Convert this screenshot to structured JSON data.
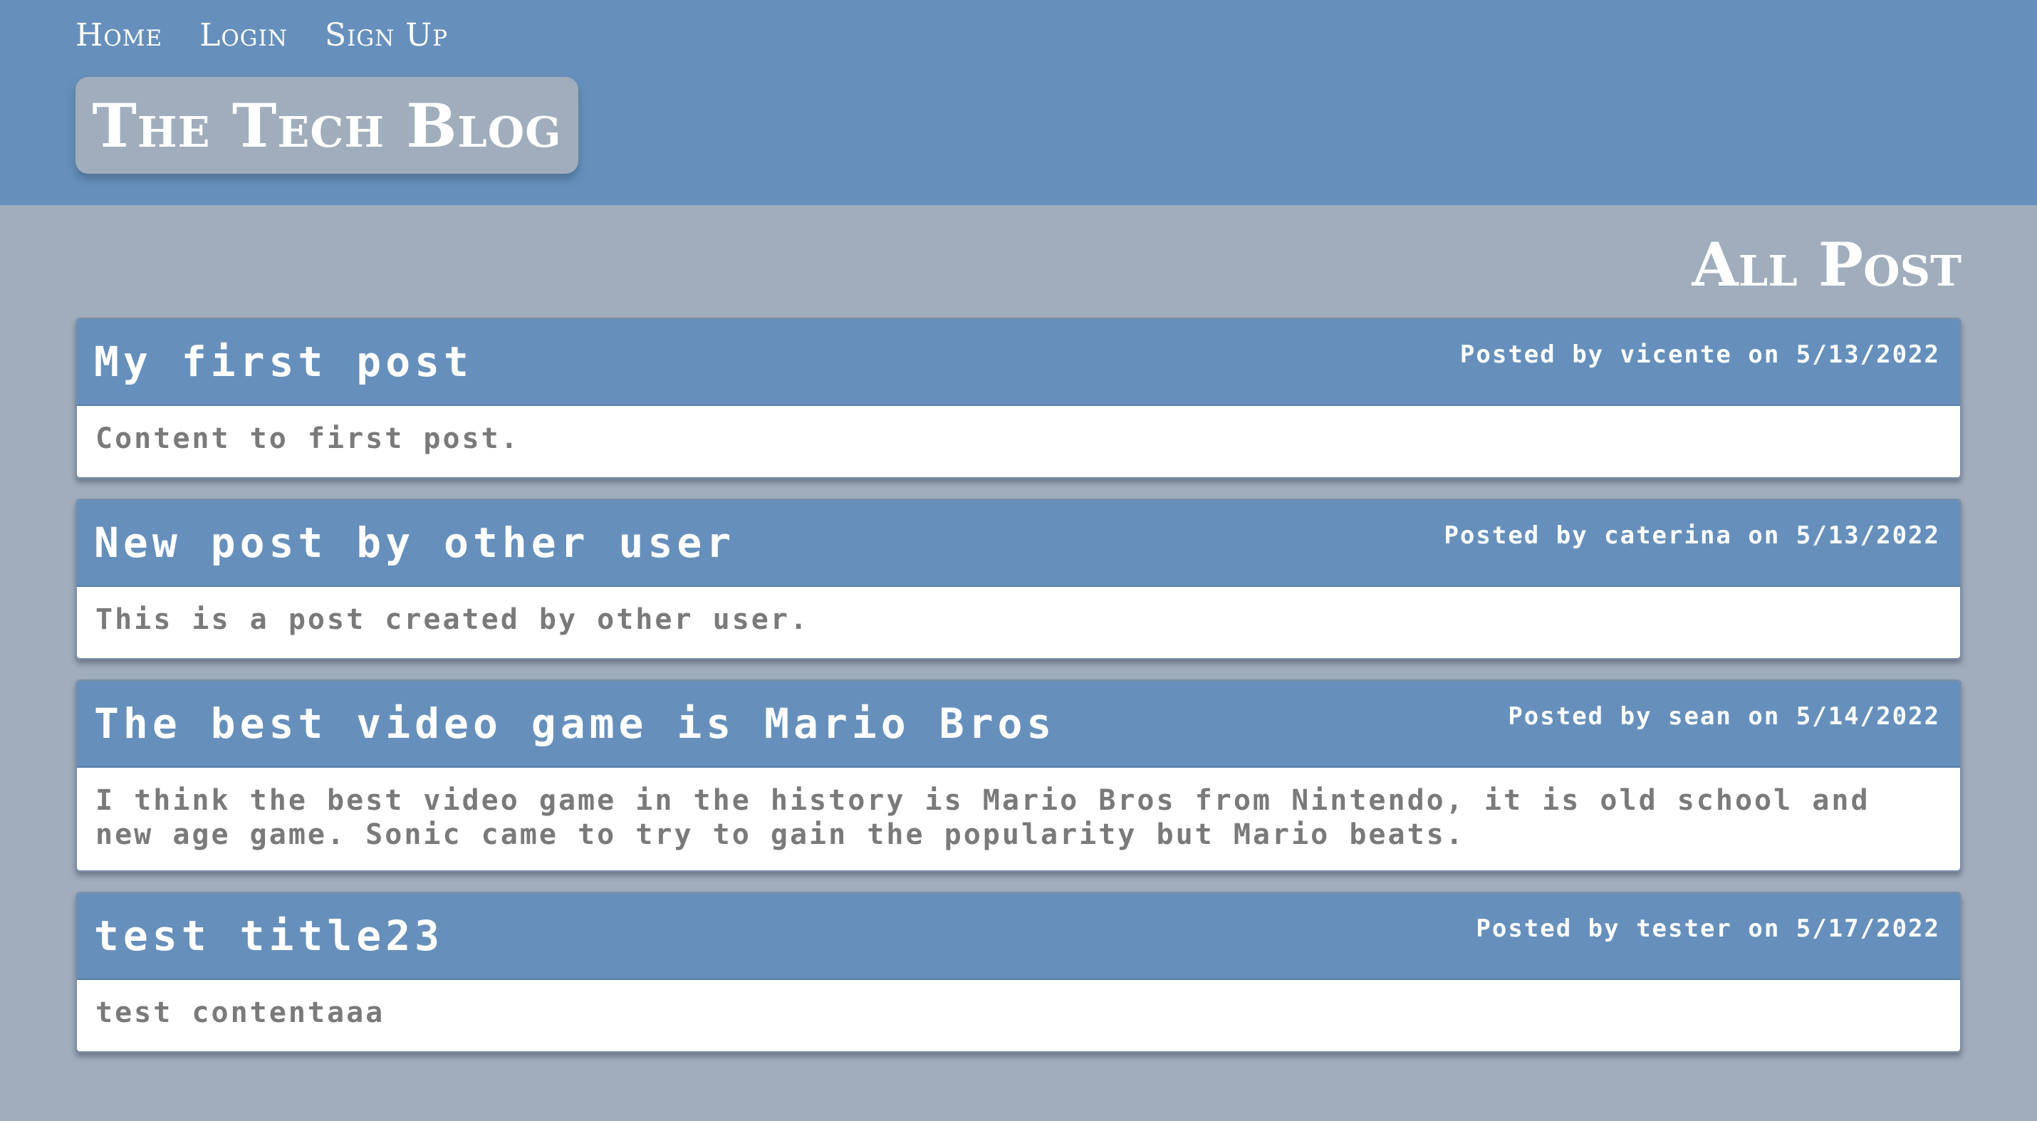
{
  "nav": {
    "home": "Home",
    "login": "Login",
    "signup": "Sign Up"
  },
  "brand": {
    "title": "The Tech Blog"
  },
  "page": {
    "heading": "All Post"
  },
  "posts": [
    {
      "title": "My first post",
      "meta": "Posted by vicente on 5/13/2022",
      "content": "Content to first post."
    },
    {
      "title": "New post by other user",
      "meta": "Posted by caterina on 5/13/2022",
      "content": "This is a post created by other user."
    },
    {
      "title": "The best video game is Mario Bros",
      "meta": "Posted by sean on 5/14/2022",
      "content": "I think the best video game in the history is Mario Bros from Nintendo, it is old school and new age game. Sonic came to try to gain the popularity but Mario beats."
    },
    {
      "title": "test title23",
      "meta": "Posted by tester on 5/17/2022",
      "content": "test contentaaa"
    }
  ],
  "colors": {
    "header_bg": "#6690bb",
    "page_bg": "#a0adbc",
    "card_bg": "#ffffff",
    "body_text": "#7a7a7a"
  }
}
